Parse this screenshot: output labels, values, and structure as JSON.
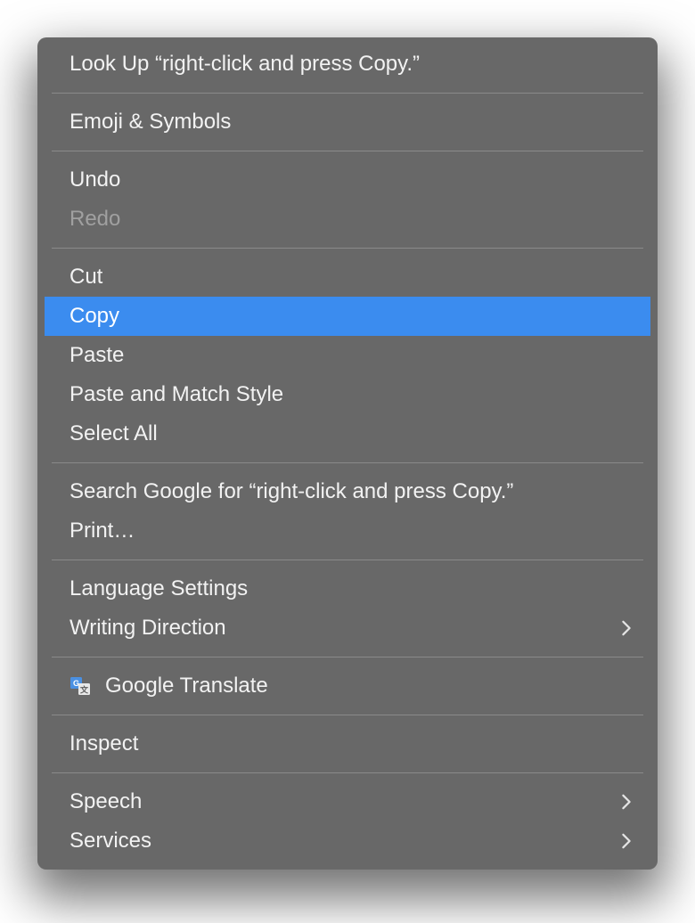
{
  "menu": {
    "groups": [
      [
        {
          "id": "lookup",
          "label": "Look Up “right-click and press Copy.”",
          "disabled": false,
          "highlighted": false,
          "submenu": false,
          "icon": null
        }
      ],
      [
        {
          "id": "emoji",
          "label": "Emoji & Symbols",
          "disabled": false,
          "highlighted": false,
          "submenu": false,
          "icon": null
        }
      ],
      [
        {
          "id": "undo",
          "label": "Undo",
          "disabled": false,
          "highlighted": false,
          "submenu": false,
          "icon": null
        },
        {
          "id": "redo",
          "label": "Redo",
          "disabled": true,
          "highlighted": false,
          "submenu": false,
          "icon": null
        }
      ],
      [
        {
          "id": "cut",
          "label": "Cut",
          "disabled": false,
          "highlighted": false,
          "submenu": false,
          "icon": null
        },
        {
          "id": "copy",
          "label": "Copy",
          "disabled": false,
          "highlighted": true,
          "submenu": false,
          "icon": null
        },
        {
          "id": "paste",
          "label": "Paste",
          "disabled": false,
          "highlighted": false,
          "submenu": false,
          "icon": null
        },
        {
          "id": "paste-match",
          "label": "Paste and Match Style",
          "disabled": false,
          "highlighted": false,
          "submenu": false,
          "icon": null
        },
        {
          "id": "select-all",
          "label": "Select All",
          "disabled": false,
          "highlighted": false,
          "submenu": false,
          "icon": null
        }
      ],
      [
        {
          "id": "search-google",
          "label": "Search Google for “right-click and press Copy.”",
          "disabled": false,
          "highlighted": false,
          "submenu": false,
          "icon": null
        },
        {
          "id": "print",
          "label": "Print…",
          "disabled": false,
          "highlighted": false,
          "submenu": false,
          "icon": null
        }
      ],
      [
        {
          "id": "language-settings",
          "label": "Language Settings",
          "disabled": false,
          "highlighted": false,
          "submenu": false,
          "icon": null
        },
        {
          "id": "writing-direction",
          "label": "Writing Direction",
          "disabled": false,
          "highlighted": false,
          "submenu": true,
          "icon": null
        }
      ],
      [
        {
          "id": "google-translate",
          "label": "Google Translate",
          "disabled": false,
          "highlighted": false,
          "submenu": false,
          "icon": "translate"
        }
      ],
      [
        {
          "id": "inspect",
          "label": "Inspect",
          "disabled": false,
          "highlighted": false,
          "submenu": false,
          "icon": null
        }
      ],
      [
        {
          "id": "speech",
          "label": "Speech",
          "disabled": false,
          "highlighted": false,
          "submenu": true,
          "icon": null
        },
        {
          "id": "services",
          "label": "Services",
          "disabled": false,
          "highlighted": false,
          "submenu": true,
          "icon": null
        }
      ]
    ]
  },
  "colors": {
    "menu_bg": "#686868",
    "highlight": "#3b8cef",
    "text": "#f2f2f2",
    "disabled_text": "#a0a0a0",
    "separator": "#8a8a8a"
  }
}
